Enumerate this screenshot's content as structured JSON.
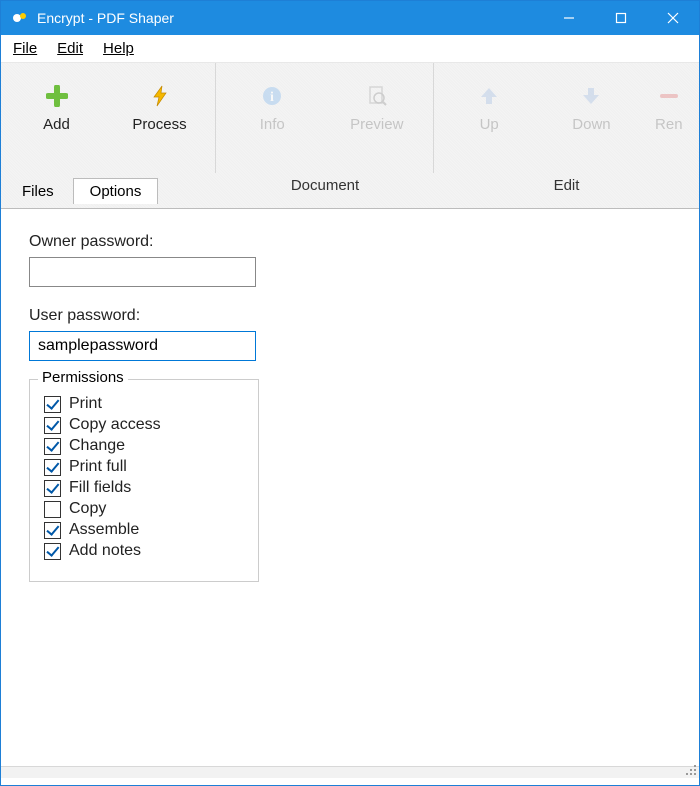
{
  "title": "Encrypt - PDF Shaper",
  "menu": {
    "file": "File",
    "edit": "Edit",
    "help": "Help"
  },
  "toolbar": {
    "groups": {
      "files": "Files",
      "document": "Document",
      "edit": "Edit"
    },
    "buttons": {
      "add": "Add",
      "process": "Process",
      "info": "Info",
      "preview": "Preview",
      "up": "Up",
      "down": "Down",
      "remove": "Ren"
    }
  },
  "tabs": {
    "files": "Files",
    "options": "Options"
  },
  "form": {
    "owner_label": "Owner password:",
    "owner_value": "",
    "user_label": "User password:",
    "user_value": "samplepassword",
    "permissions_legend": "Permissions",
    "permissions": [
      {
        "label": "Print",
        "checked": true
      },
      {
        "label": "Copy access",
        "checked": true
      },
      {
        "label": "Change",
        "checked": true
      },
      {
        "label": "Print full",
        "checked": true
      },
      {
        "label": "Fill fields",
        "checked": true
      },
      {
        "label": "Copy",
        "checked": false
      },
      {
        "label": "Assemble",
        "checked": true
      },
      {
        "label": "Add notes",
        "checked": true
      }
    ]
  }
}
